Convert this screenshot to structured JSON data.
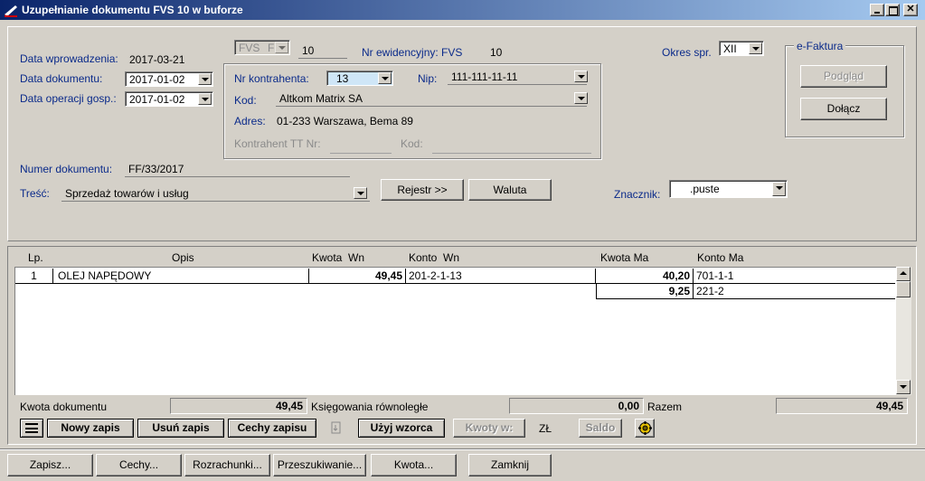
{
  "window": {
    "title": "Uzupełnianie dokumentu FVS 10 w buforze"
  },
  "header": {
    "data_wprowadzenia_label": "Data wprowadzenia:",
    "data_wprowadzenia_value": "2017-03-21",
    "data_dokumentu_label": "Data dokumentu:",
    "data_dokumentu_value": "2017-01-02",
    "data_operacji_label": "Data operacji gosp.:",
    "data_operacji_value": "2017-01-02",
    "doc_type_value": "FVS",
    "doc_type_suffix": "F",
    "doc_number_value": "10",
    "nr_ewid_label": "Nr ewidencyjny: FVS",
    "nr_ewid_value": "10",
    "okres_label": "Okres spr.",
    "okres_value": "XII"
  },
  "kontrahent": {
    "nr_label": "Nr kontrahenta:",
    "nr_value": "13",
    "nip_label": "Nip:",
    "nip_value": "111-111-11-11",
    "kod_label": "Kod:",
    "kod_value": "Altkom Matrix SA",
    "adres_label": "Adres:",
    "adres_value": "01-233 Warszawa, Bema 89",
    "tt_label": "Kontrahent TT Nr:",
    "tt_kod_label": "Kod:"
  },
  "efaktura": {
    "title": "e-Faktura",
    "podglad": "Podgląd",
    "dolacz": "Dołącz"
  },
  "doc": {
    "numer_label": "Numer dokumentu:",
    "numer_value": "FF/33/2017",
    "tresc_label": "Treść:",
    "tresc_value": "Sprzedaż towarów i usług",
    "rejestr_btn": "Rejestr >>",
    "waluta_btn": "Waluta",
    "znacznik_label": "Znacznik:",
    "znacznik_value": ".puste"
  },
  "table": {
    "columns": [
      "Lp.",
      "Opis",
      "Kwota  Wn",
      "Konto  Wn",
      "Kwota Ma",
      "Konto Ma"
    ],
    "rows": [
      {
        "lp": "1",
        "opis": "OLEJ NAPĘDOWY",
        "kwota_wn": "49,45",
        "konto_wn": "201-2-1-13",
        "kwota_ma": "40,20",
        "konto_ma": "701-1-1"
      },
      {
        "lp": "",
        "opis": "",
        "kwota_wn": "",
        "konto_wn": "",
        "kwota_ma": "9,25",
        "konto_ma": "221-2"
      }
    ]
  },
  "totals": {
    "kwota_dok_label": "Kwota dokumentu",
    "kwota_dok_value": "49,45",
    "ksieg_label": "Księgowania równoległe",
    "ksieg_value": "0,00",
    "razem_label": "Razem",
    "razem_value": "49,45"
  },
  "toolbar": {
    "nowy": "Nowy zapis",
    "usun": "Usuń zapis",
    "cechy_zapisu": "Cechy zapisu",
    "uzyj_wzorca": "Użyj wzorca",
    "kwoty_w": "Kwoty w:",
    "currency": "ZŁ",
    "saldo": "Saldo"
  },
  "footer": {
    "zapisz": "Zapisz...",
    "cechy": "Cechy...",
    "rozrachunki": "Rozrachunki...",
    "przeszukiwanie": "Przeszukiwanie...",
    "kwota": "Kwota...",
    "zamknij": "Zamknij"
  },
  "colors": {
    "titlebar": "#0a246a",
    "titlebar_end": "#a6caf0",
    "label": "#0a2a8a",
    "nr_kontrahenta_bg": "#cfe6f7"
  }
}
